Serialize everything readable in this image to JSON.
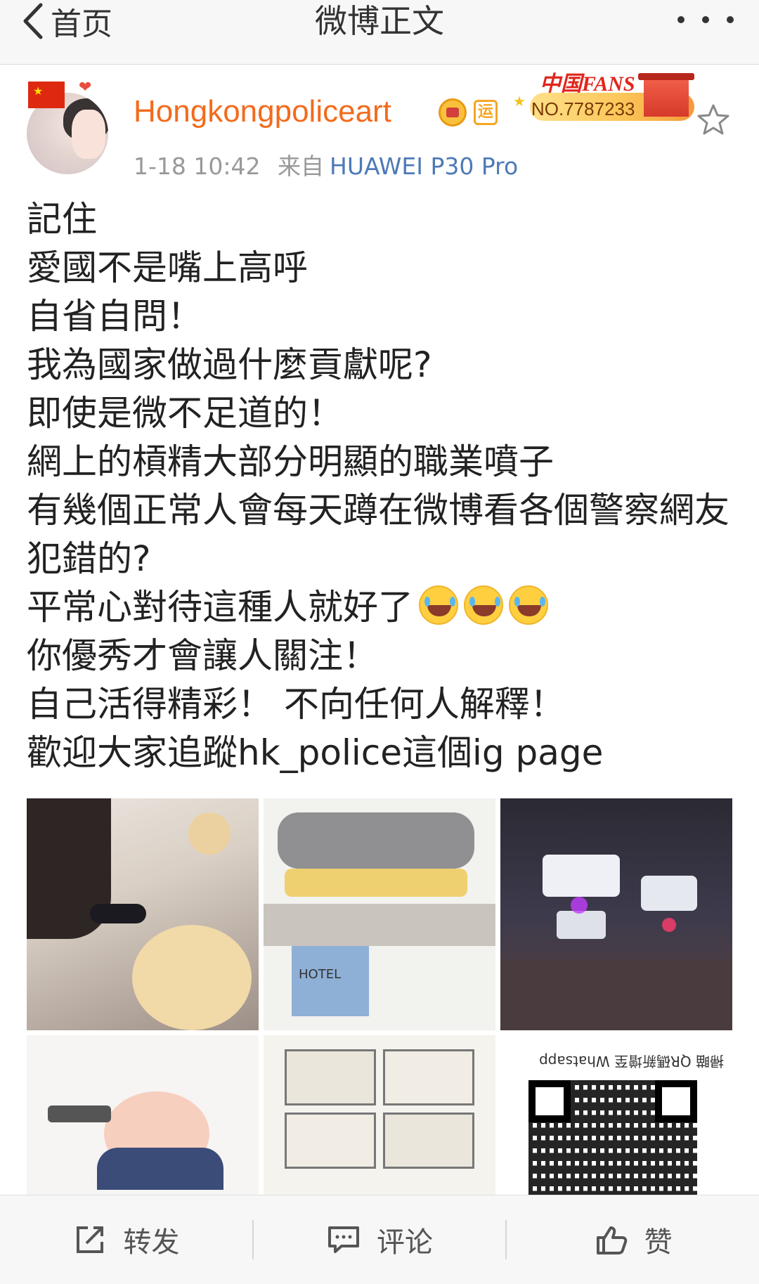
{
  "nav": {
    "back_label": "首页",
    "title": "微博正文"
  },
  "post": {
    "username": "Hongkongpoliceart",
    "badge_yun": "运",
    "fans_badge": {
      "brand": "中国FANS",
      "number": "NO.7787233"
    },
    "time": "1-18 10:42",
    "from_label": "来自",
    "source": "HUAWEI P30 Pro",
    "lines": [
      "記住",
      "愛國不是嘴上高呼",
      "自省自問！",
      "我為國家做過什麼貢獻呢?",
      "即使是微不足道的！",
      "網上的槓精大部分明顯的職業噴子",
      "有幾個正常人會每天蹲在微博看各個警察網友犯錯的?",
      "平常心對待這種人就好了",
      "你優秀才會讓人關注！",
      "自己活得精彩！ 不向任何人解釋！",
      "歡迎大家追蹤hk_police這個ig page"
    ],
    "image_texts": {
      "hotel_sign": "HOTEL",
      "qr_caption": "掃瞄 QR碼新增至 Whatsapp"
    }
  },
  "toolbar": {
    "repost_label": "转发",
    "comment_label": "评论",
    "like_label": "赞"
  },
  "colors": {
    "username": "#f26b1d",
    "source_link": "#4d7ab7",
    "meta": "#999999"
  },
  "icons": [
    "chevron-left-icon",
    "more-icon",
    "star-icon",
    "crown-icon",
    "share-icon",
    "comment-icon",
    "thumbs-up-icon"
  ]
}
